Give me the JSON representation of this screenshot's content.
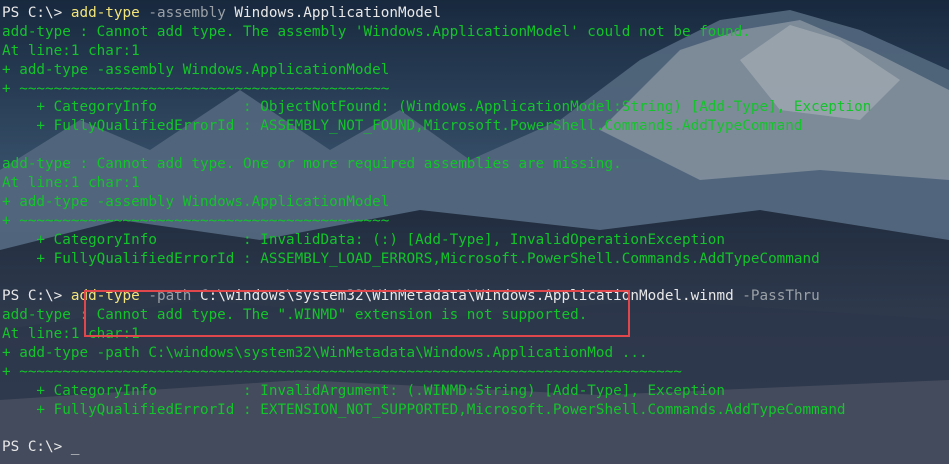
{
  "terminal": {
    "lines": [
      {
        "segments": [
          {
            "cls": "prompt",
            "text": "PS C:\\> "
          },
          {
            "cls": "cmd",
            "text": "add-type"
          },
          {
            "cls": "param",
            "text": " -assembly"
          },
          {
            "cls": "arg",
            "text": " Windows.ApplicationModel"
          }
        ]
      },
      {
        "segments": [
          {
            "cls": "err",
            "text": "add-type : Cannot add type. The assembly 'Windows.ApplicationModel' could not be found."
          }
        ]
      },
      {
        "segments": [
          {
            "cls": "err",
            "text": "At line:1 char:1"
          }
        ]
      },
      {
        "segments": [
          {
            "cls": "err",
            "text": "+ add-type -assembly Windows.ApplicationModel"
          }
        ]
      },
      {
        "segments": [
          {
            "cls": "err",
            "text": "+ ~~~~~~~~~~~~~~~~~~~~~~~~~~~~~~~~~~~~~~~~~~~"
          }
        ]
      },
      {
        "segments": [
          {
            "cls": "err",
            "text": "    + CategoryInfo          : ObjectNotFound: (Windows.ApplicationModel:String) [Add-Type], Exception"
          }
        ]
      },
      {
        "segments": [
          {
            "cls": "err",
            "text": "    + FullyQualifiedErrorId : ASSEMBLY_NOT_FOUND,Microsoft.PowerShell.Commands.AddTypeCommand"
          }
        ]
      },
      {
        "segments": [
          {
            "cls": "err",
            "text": ""
          }
        ]
      },
      {
        "segments": [
          {
            "cls": "err",
            "text": "add-type : Cannot add type. One or more required assemblies are missing."
          }
        ]
      },
      {
        "segments": [
          {
            "cls": "err",
            "text": "At line:1 char:1"
          }
        ]
      },
      {
        "segments": [
          {
            "cls": "err",
            "text": "+ add-type -assembly Windows.ApplicationModel"
          }
        ]
      },
      {
        "segments": [
          {
            "cls": "err",
            "text": "+ ~~~~~~~~~~~~~~~~~~~~~~~~~~~~~~~~~~~~~~~~~~~"
          }
        ]
      },
      {
        "segments": [
          {
            "cls": "err",
            "text": "    + CategoryInfo          : InvalidData: (:) [Add-Type], InvalidOperationException"
          }
        ]
      },
      {
        "segments": [
          {
            "cls": "err",
            "text": "    + FullyQualifiedErrorId : ASSEMBLY_LOAD_ERRORS,Microsoft.PowerShell.Commands.AddTypeCommand"
          }
        ]
      },
      {
        "segments": [
          {
            "cls": "err",
            "text": ""
          }
        ]
      },
      {
        "segments": [
          {
            "cls": "prompt",
            "text": "PS C:\\> "
          },
          {
            "cls": "cmd",
            "text": "add-type"
          },
          {
            "cls": "param",
            "text": " -path"
          },
          {
            "cls": "arg",
            "text": " C:\\windows\\system32\\WinMetadata\\Windows.ApplicationModel.winmd"
          },
          {
            "cls": "param",
            "text": " -PassThru"
          }
        ]
      },
      {
        "segments": [
          {
            "cls": "err",
            "text": "add-type : Cannot add type. The \".WINMD\" extension is not supported."
          }
        ]
      },
      {
        "segments": [
          {
            "cls": "err",
            "text": "At line:1 char:1"
          }
        ]
      },
      {
        "segments": [
          {
            "cls": "err",
            "text": "+ add-type -path C:\\windows\\system32\\WinMetadata\\Windows.ApplicationMod ..."
          }
        ]
      },
      {
        "segments": [
          {
            "cls": "err",
            "text": "+ ~~~~~~~~~~~~~~~~~~~~~~~~~~~~~~~~~~~~~~~~~~~~~~~~~~~~~~~~~~~~~~~~~~~~~~~~~~~~~"
          }
        ]
      },
      {
        "segments": [
          {
            "cls": "err",
            "text": "    + CategoryInfo          : InvalidArgument: (.WINMD:String) [Add-Type], Exception"
          }
        ]
      },
      {
        "segments": [
          {
            "cls": "err",
            "text": "    + FullyQualifiedErrorId : EXTENSION_NOT_SUPPORTED,Microsoft.PowerShell.Commands.AddTypeCommand"
          }
        ]
      },
      {
        "segments": [
          {
            "cls": "err",
            "text": ""
          }
        ]
      },
      {
        "segments": [
          {
            "cls": "prompt",
            "text": "PS C:\\> "
          },
          {
            "cls": "cursor",
            "text": "_"
          }
        ]
      }
    ]
  },
  "colors": {
    "error_text": "#13c42a",
    "prompt_text": "#e8e8e8",
    "command_text": "#f2e47a",
    "parameter_text": "#9aa0a6",
    "highlight_border": "#e0474c"
  }
}
